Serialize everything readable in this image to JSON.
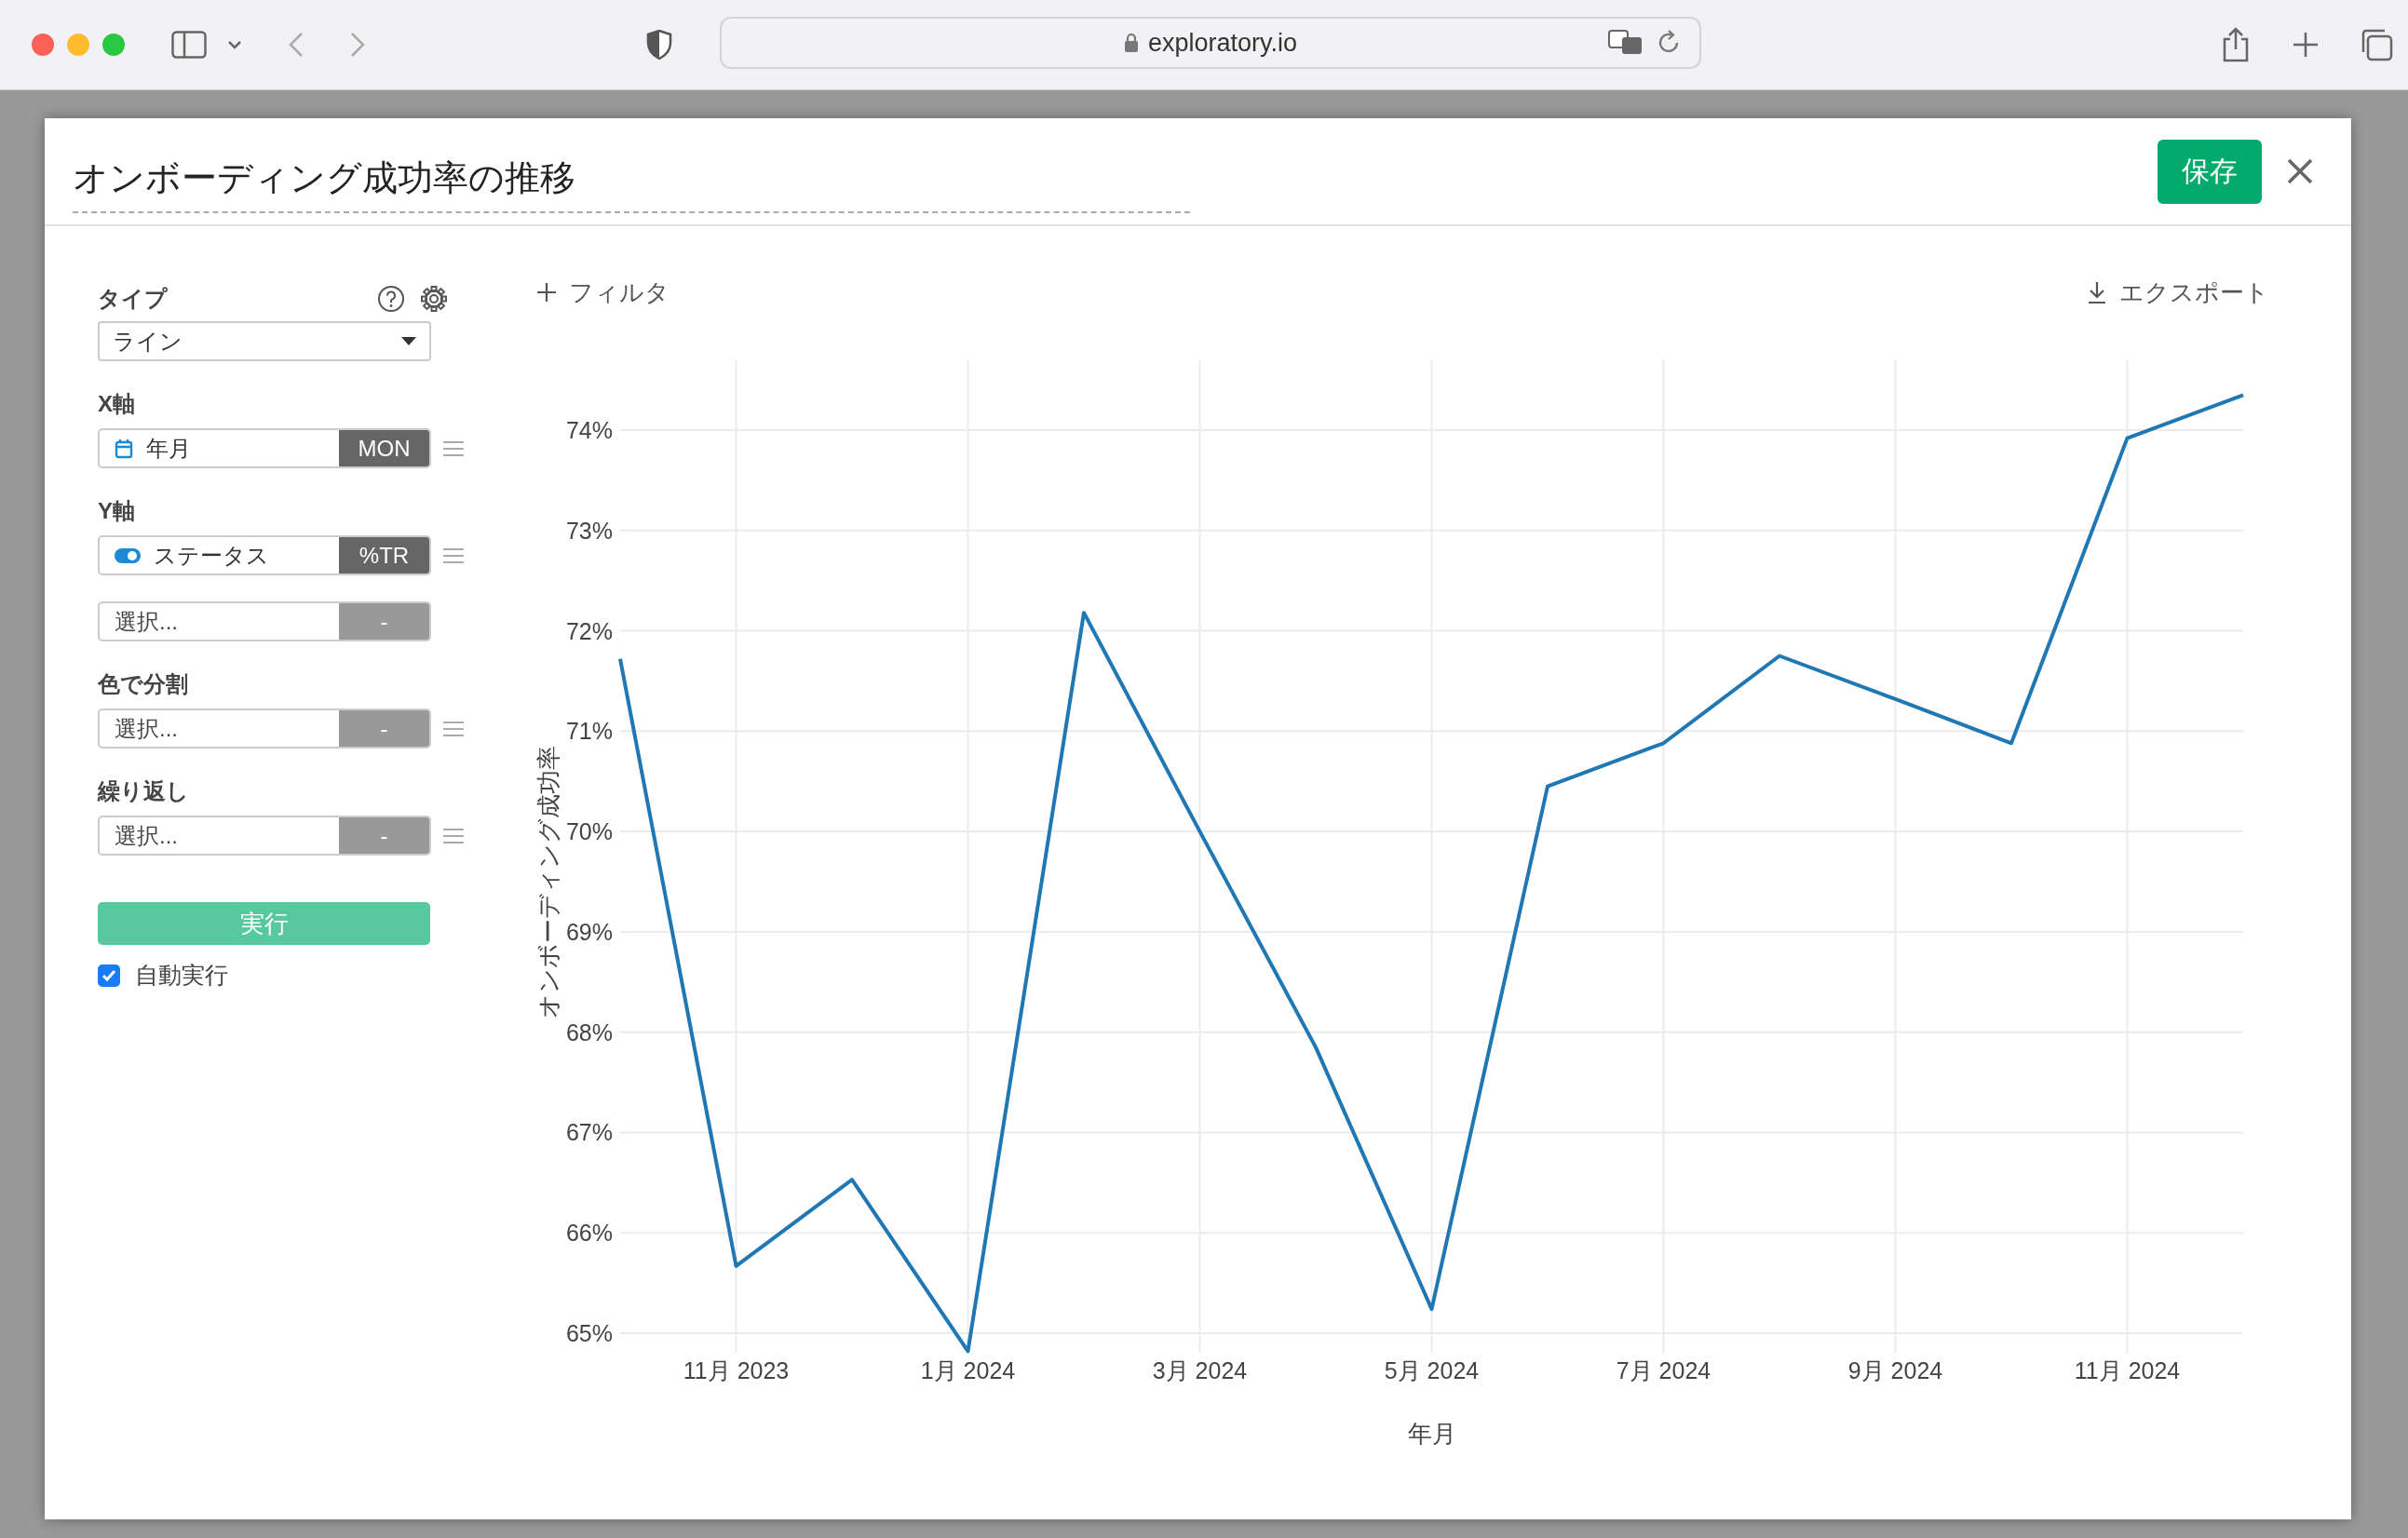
{
  "browser": {
    "url": "exploratory.io"
  },
  "dialog": {
    "title": "オンボーディング成功率の推移",
    "save_button": "保存"
  },
  "settings": {
    "type_label": "タイプ",
    "type_value": "ライン",
    "fields": [
      {
        "kind": "date",
        "label": "X軸",
        "value": "年月",
        "tag": "MON",
        "has_menu": true
      },
      {
        "kind": "toggle",
        "label": "Y軸",
        "value": "ステータス",
        "tag": "%TR",
        "has_menu": true
      },
      {
        "kind": "empty",
        "placeholder": "選択...",
        "tag": "-",
        "has_menu": false
      },
      {
        "kind": "empty",
        "label": "色で分割",
        "placeholder": "選択...",
        "tag": "-",
        "has_menu": true
      },
      {
        "kind": "empty",
        "label": "繰り返し",
        "placeholder": "選択...",
        "tag": "-",
        "has_menu": true
      }
    ],
    "run_button": "実行",
    "auto_run": {
      "label": "自動実行",
      "checked": true
    }
  },
  "chart_toolbar": {
    "filter": "フィルタ",
    "export": "エクスポート"
  },
  "chart": {
    "chart_data": {
      "type": "line",
      "xlabel": "年月",
      "ylabel": "オンボーディング成功率",
      "categories": [
        null,
        "11月 2023",
        null,
        "1月 2024",
        null,
        "3月 2024",
        null,
        "5月 2024",
        null,
        "7月 2024",
        null,
        "9月 2024",
        null,
        "11月 2024",
        null
      ],
      "series": [
        {
          "color": "#1f77b4",
          "values": [
            71.72,
            65.67,
            66.53,
            64.82,
            72.18,
            70.0,
            67.85,
            65.24,
            70.45,
            70.88,
            71.75,
            71.32,
            70.88,
            73.92,
            74.35
          ]
        }
      ],
      "grid": true,
      "ylim": [
        64.8,
        74.7
      ],
      "yticks": [
        {
          "value": 65,
          "label": "65%"
        },
        {
          "value": 66,
          "label": "66%"
        },
        {
          "value": 67,
          "label": "67%"
        },
        {
          "value": 68,
          "label": "68%"
        },
        {
          "value": 69,
          "label": "69%"
        },
        {
          "value": 70,
          "label": "70%"
        },
        {
          "value": 71,
          "label": "71%"
        },
        {
          "value": 72,
          "label": "72%"
        },
        {
          "value": 73,
          "label": "73%"
        },
        {
          "value": 74,
          "label": "74%"
        }
      ]
    }
  }
}
